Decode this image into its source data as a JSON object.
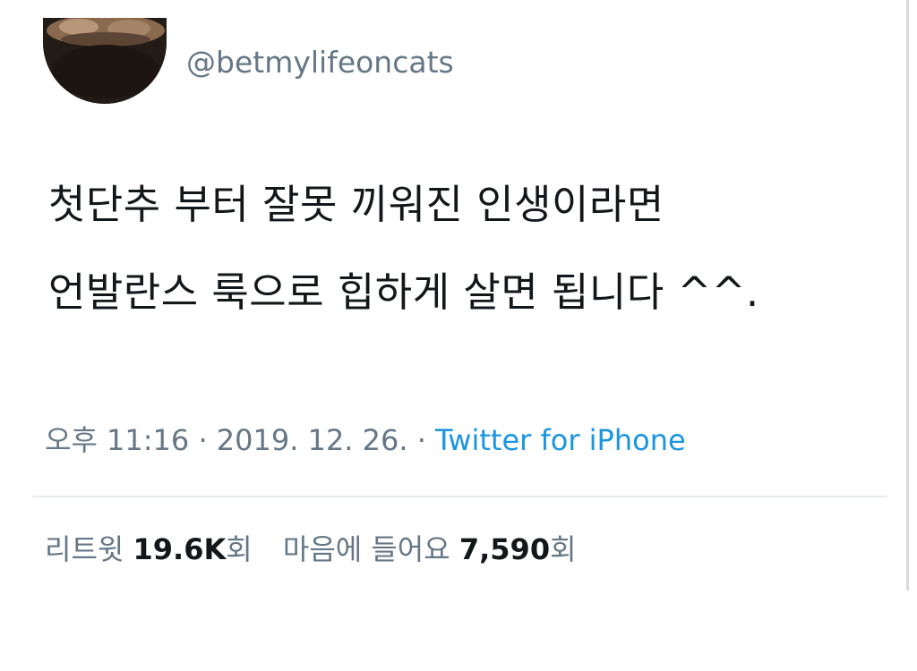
{
  "tweet": {
    "handle": "@betmylifeoncats",
    "text_line1": "첫단추 부터 잘못 끼워진 인생이라면",
    "text_line2": "언발란스 룩으로 힙하게 살면 됩니다 ^^.",
    "time": "오후 11:16",
    "date": "2019. 12. 26.",
    "separator": "·",
    "source": "Twitter for iPhone"
  },
  "stats": {
    "retweets_label": "리트윗",
    "retweets_count": "19.6K",
    "retweets_suffix": "회",
    "likes_label": "마음에 들어요",
    "likes_count": "7,590",
    "likes_suffix": "회"
  },
  "colors": {
    "text": "#14171a",
    "secondary": "#657786",
    "link": "#1b95e0",
    "divider": "#e6ecf0",
    "background": "#ffffff"
  },
  "icons": {
    "avatar": "cat-photo-avatar"
  }
}
